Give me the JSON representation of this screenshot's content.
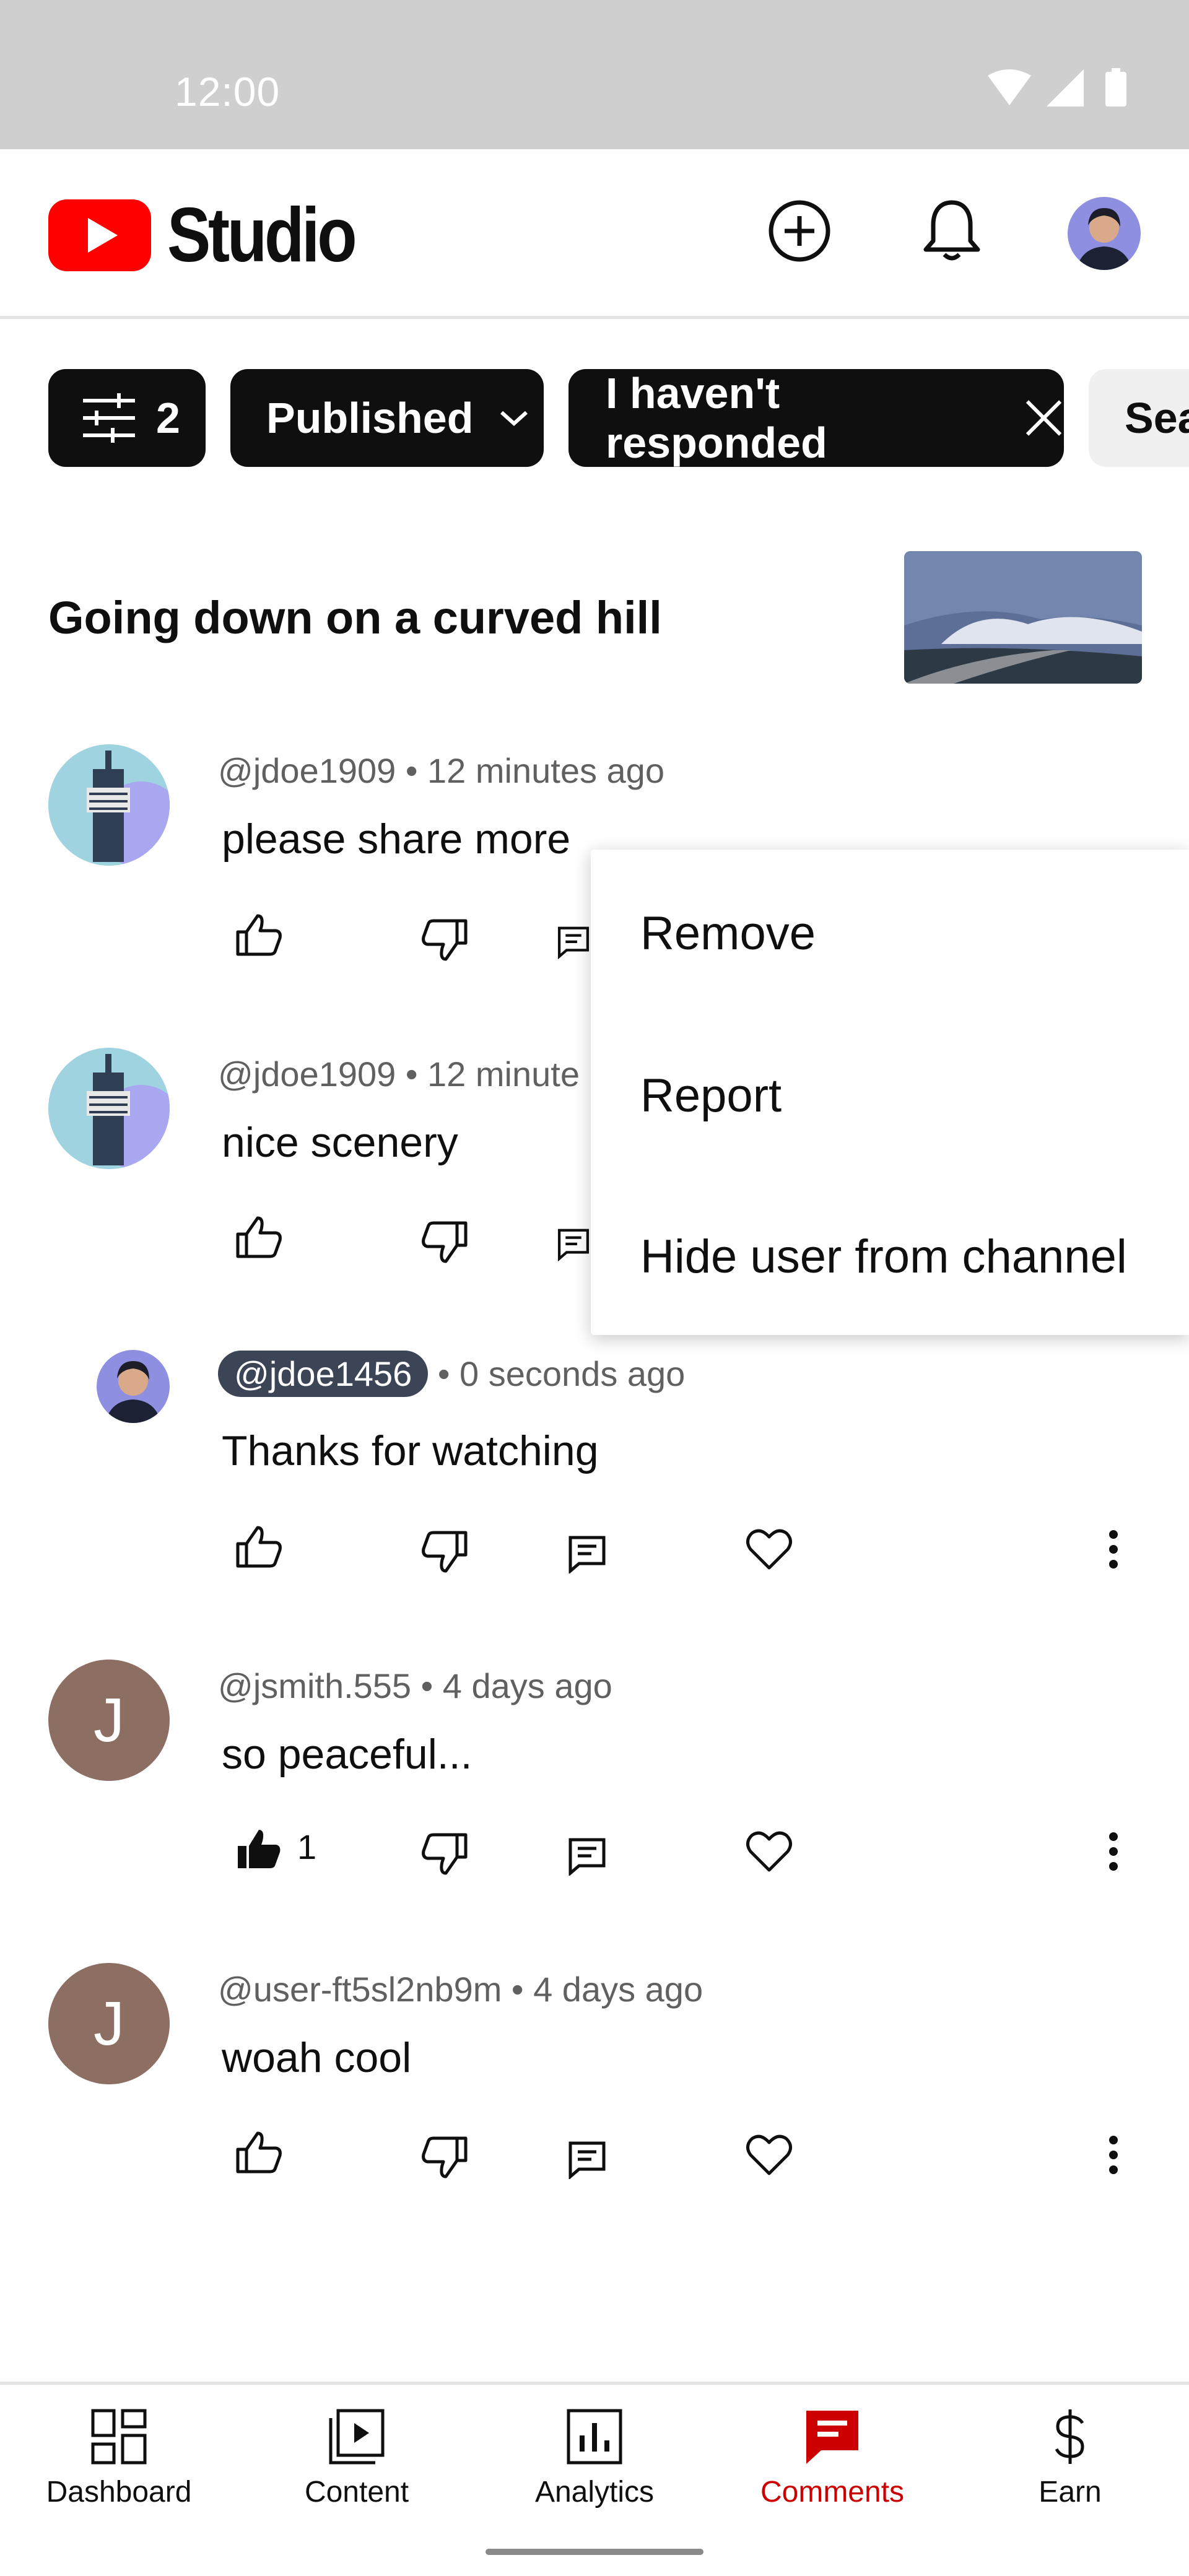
{
  "status_bar": {
    "time": "12:00"
  },
  "app_bar": {
    "logo_text": "Studio"
  },
  "filters": {
    "filter_count": "2",
    "published": "Published",
    "response": "I haven't responded",
    "search_partial": "Sea"
  },
  "video": {
    "title": "Going down on a curved hill"
  },
  "comments": [
    {
      "author": "@jdoe1909",
      "meta": " • 12 minutes ago",
      "text": "please share more",
      "likes": ""
    },
    {
      "author": "@jdoe1909",
      "meta": " • 12 minute",
      "text": "nice scenery",
      "likes": ""
    },
    {
      "author": "@jdoe1456",
      "meta": " • 0 seconds ago",
      "text": "Thanks for watching",
      "likes": "",
      "is_creator_reply": true
    },
    {
      "author": "@jsmith.555",
      "meta": " • 4 days ago",
      "text": "so peaceful...",
      "likes": "1",
      "avatar_letter": "J"
    },
    {
      "author": "@user-ft5sl2nb9m",
      "meta": " • 4 days ago",
      "text": "woah cool",
      "likes": "",
      "avatar_letter": "J"
    }
  ],
  "menu": {
    "items": [
      "Remove",
      "Report",
      "Hide user from channel"
    ]
  },
  "bottom_nav": {
    "items": [
      {
        "label": "Dashboard",
        "icon": "dashboard-icon"
      },
      {
        "label": "Content",
        "icon": "content-icon"
      },
      {
        "label": "Analytics",
        "icon": "analytics-icon"
      },
      {
        "label": "Comments",
        "icon": "comments-icon",
        "active": true
      },
      {
        "label": "Earn",
        "icon": "dollar-icon"
      }
    ]
  },
  "colors": {
    "accent": "#cc0000",
    "logo_red": "#ff0000",
    "chip_dark": "#0f0f0f"
  }
}
